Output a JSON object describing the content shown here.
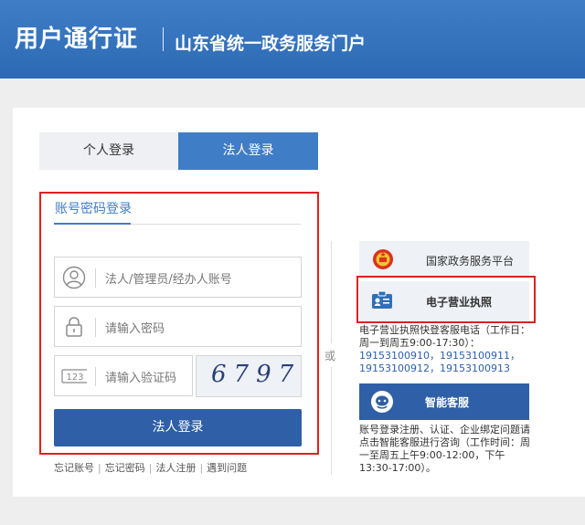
{
  "header": {
    "brand": "用户通行证",
    "portal": "山东省统一政务服务门户"
  },
  "tabs": [
    {
      "label": "个人登录",
      "active": false
    },
    {
      "label": "法人登录",
      "active": true
    }
  ],
  "login": {
    "subtab_label": "账号密码登录",
    "account_placeholder": "法人/管理员/经办人账号",
    "password_placeholder": "请输入密码",
    "captcha_placeholder": "请输入验证码",
    "captcha_code": "6797",
    "submit_label": "法人登录",
    "links": [
      "忘记账号",
      "忘记密码",
      "法人注册",
      "遇到问题"
    ]
  },
  "separator": {
    "or_label": "或"
  },
  "side": {
    "national_platform": "国家政务服务平台",
    "e_license": "电子营业执照",
    "license_hotline": {
      "text": "电子营业执照快登客服电话（工作日：周一到周五9:00-17:30）：",
      "phones_line1": "19153100910，19153100911，",
      "phones_line2": "19153100912，19153100913"
    },
    "smart_service": "智能客服",
    "service_note": "账号登录注册、认证、企业绑定问题请点击智能客服进行咨询（工作时间：周一至周五上午9:00-12:00，下午13:30-17:00）。"
  },
  "colors": {
    "header_blue": "#3f7dc6",
    "button_blue": "#2f5fa6",
    "highlight_red": "#e02020",
    "link_blue": "#2c5fa8"
  },
  "icons": [
    "user-icon",
    "lock-icon",
    "captcha-123-icon",
    "national-emblem-icon",
    "id-card-icon",
    "chat-service-icon"
  ]
}
